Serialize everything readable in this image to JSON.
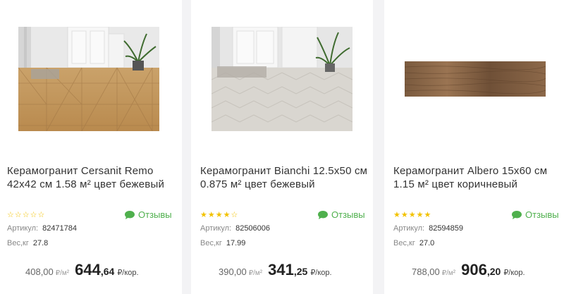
{
  "products": [
    {
      "title": "Керамогранит Cersanit Remo 42x42 см 1.58 м² цвет бежевый",
      "image": "floor-parquet-beige-room",
      "stars": "☆☆☆☆☆",
      "rating": 0,
      "reviews_label": "Отзывы",
      "sku_label": "Артикул:",
      "sku": "82471784",
      "weight_label": "Вес,кг",
      "weight": "27.8",
      "old_price": "408,00",
      "old_unit": "₽/м²",
      "price_int": "644",
      "price_dec": ",64",
      "price_unit": "₽/кор."
    },
    {
      "title": "Керамогранит Bianchi 12.5x50 см 0.875 м² цвет бежевый",
      "image": "floor-herringbone-light-room",
      "stars": "★★★★☆",
      "rating": 4,
      "reviews_label": "Отзывы",
      "sku_label": "Артикул:",
      "sku": "82506006",
      "weight_label": "Вес,кг",
      "weight": "17.99",
      "old_price": "390,00",
      "old_unit": "₽/м²",
      "price_int": "341",
      "price_dec": ",25",
      "price_unit": "₽/кор."
    },
    {
      "title": "Керамогранит Albero 15x60 см 1.15 м² цвет коричневый",
      "image": "wood-plank-tile",
      "stars": "★★★★★",
      "rating": 5,
      "reviews_label": "Отзывы",
      "sku_label": "Артикул:",
      "sku": "82594859",
      "weight_label": "Вес,кг",
      "weight": "27.0",
      "old_price": "788,00",
      "old_unit": "₽/м²",
      "price_int": "906",
      "price_dec": ",20",
      "price_unit": "₽/кор."
    }
  ],
  "colors": {
    "accent_green": "#4fb04d",
    "star": "#f2c200",
    "background": "#f3f3f5"
  }
}
